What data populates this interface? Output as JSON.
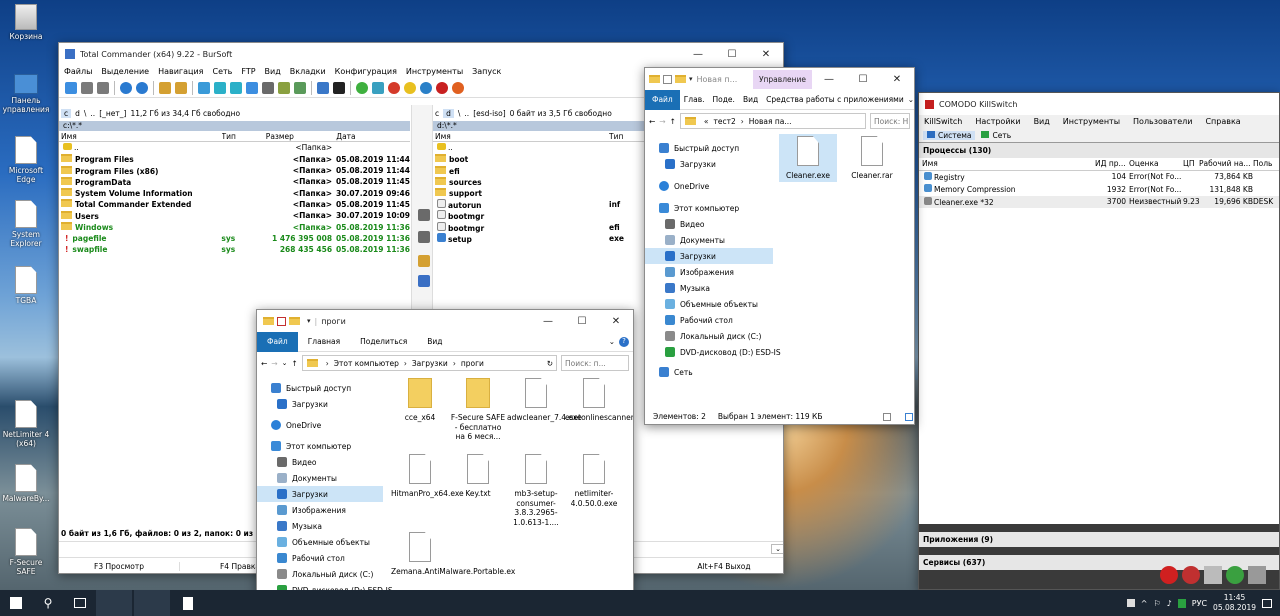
{
  "desktop": {
    "icons": [
      "Корзина",
      "Панель управления",
      "Microsoft Edge",
      "System Explorer",
      "TGBA",
      "NetLimiter 4 (x64)",
      "MalwareBy...",
      "F-Secure SAFE"
    ]
  },
  "tc": {
    "title": "Total Commander (x64) 9.22 - BurSoft",
    "menu": [
      "Файлы",
      "Выделение",
      "Навигация",
      "Сеть",
      "FTP",
      "Вид",
      "Вкладки",
      "Конфигурация",
      "Инструменты",
      "Запуск"
    ],
    "left": {
      "drive": "c",
      "drive2": "d",
      "backslash": "\\",
      "dots": "..",
      "label": "[_нет_]",
      "free": "11,2 Гб из 34,4 Гб свободно",
      "path": "c:\\*.*",
      "headers": [
        "Имя",
        "Тип",
        "Размер",
        "Дата"
      ],
      "rows": [
        {
          "name": "..",
          "type": "",
          "size": "<Папка>",
          "date": "",
          "cls": ""
        },
        {
          "name": "Program Files",
          "type": "",
          "size": "<Папка>",
          "date": "05.08.2019 11:44",
          "cls": ""
        },
        {
          "name": "Program Files (x86)",
          "type": "",
          "size": "<Папка>",
          "date": "05.08.2019 11:44",
          "cls": ""
        },
        {
          "name": "ProgramData",
          "type": "",
          "size": "<Папка>",
          "date": "05.08.2019 11:45",
          "cls": ""
        },
        {
          "name": "System Volume Information",
          "type": "",
          "size": "<Папка>",
          "date": "30.07.2019 09:46",
          "cls": ""
        },
        {
          "name": "Total Commander Extended",
          "type": "",
          "size": "<Папка>",
          "date": "05.08.2019 11:45",
          "cls": ""
        },
        {
          "name": "Users",
          "type": "",
          "size": "<Папка>",
          "date": "30.07.2019 10:09",
          "cls": ""
        },
        {
          "name": "Windows",
          "type": "",
          "size": "<Папка>",
          "date": "05.08.2019 11:36",
          "cls": "green"
        },
        {
          "name": "pagefile",
          "type": "sys",
          "size": "1 476 395 008",
          "date": "05.08.2019 11:36",
          "cls": "green"
        },
        {
          "name": "swapfile",
          "type": "sys",
          "size": "268 435 456",
          "date": "05.08.2019 11:36",
          "cls": "green"
        }
      ],
      "status": "0 байт из 1,6 Гб, файлов: 0 из 2, папок: 0 из 11"
    },
    "right": {
      "drive": "c",
      "drive2": "d",
      "backslash": "\\",
      "dots": "..",
      "label": "[esd-iso]",
      "free": "0 байт из 3,5 Гб свободно",
      "path": "d:\\*.*",
      "headers": [
        "Имя",
        "Тип"
      ],
      "rows": [
        {
          "name": "..",
          "type": ""
        },
        {
          "name": "boot",
          "type": ""
        },
        {
          "name": "efi",
          "type": ""
        },
        {
          "name": "sources",
          "type": ""
        },
        {
          "name": "support",
          "type": ""
        },
        {
          "name": "autorun",
          "type": "inf"
        },
        {
          "name": "bootmgr",
          "type": ""
        },
        {
          "name": "bootmgr",
          "type": "efi"
        },
        {
          "name": "setup",
          "type": "exe"
        }
      ]
    },
    "fkeys": [
      "F3 Просмотр",
      "F4 Правка",
      "Alt+F4 Выход"
    ]
  },
  "exp1": {
    "title": "проги",
    "tabs": [
      "Файл",
      "Главная",
      "Поделиться",
      "Вид"
    ],
    "crumbs": [
      "Этот компьютер",
      "Загрузки",
      "проги"
    ],
    "search": "Поиск: п...",
    "nav": [
      "Быстрый доступ",
      "Загрузки",
      "OneDrive",
      "Этот компьютер",
      "Видео",
      "Документы",
      "Загрузки",
      "Изображения",
      "Музыка",
      "Объемные объекты",
      "Рабочий стол",
      "Локальный диск (C:)",
      "DVD-дисковод (D:) ESD-IS"
    ],
    "files": [
      "cce_x64",
      "F-Secure SAFE - бесплатно на 6 меся...",
      "adwcleaner_7.4.exe",
      "esetonlinescanner_rus.exe",
      "HitmanPro_x64.exe",
      "Key.txt",
      "mb3-setup-consumer-3.8.3.2965-1.0.613-1....",
      "netlimiter-4.0.50.0.exe",
      "Zemana.AntiMalware.Portable.ex"
    ]
  },
  "exp2": {
    "title": "Новая п...",
    "ribbon_extra": "Управление",
    "tabs": [
      "Файл",
      "Глав.",
      "Поде.",
      "Вид",
      "Средства работы с приложениями"
    ],
    "crumbs": [
      "тест2",
      "Новая па..."
    ],
    "search": "Поиск: Н",
    "nav": [
      "Быстрый доступ",
      "Загрузки",
      "OneDrive",
      "Этот компьютер",
      "Видео",
      "Документы",
      "Загрузки",
      "Изображения",
      "Музыка",
      "Объемные объекты",
      "Рабочий стол",
      "Локальный диск (C:)",
      "DVD-дисковод (D:) ESD-IS",
      "Сеть"
    ],
    "files": [
      "Cleaner.exe",
      "Cleaner.rar"
    ],
    "status_count": "Элементов: 2",
    "status_sel": "Выбран 1 элемент: 119 КБ"
  },
  "killswitch": {
    "title": "COMODO KillSwitch",
    "menu": [
      "KillSwitch",
      "Настройки",
      "Вид",
      "Инструменты",
      "Пользователи",
      "Справка"
    ],
    "tabs": [
      "Система",
      "Сеть"
    ],
    "processes_header": "Процессы (130)",
    "columns": [
      "Имя",
      "ИД пр...",
      "Оценка",
      "ЦП",
      "Рабочий на...",
      "Поль"
    ],
    "rows": [
      {
        "name": "Registry",
        "pid": "104",
        "rating": "Error(Not Fo...",
        "cpu": "",
        "mem": "73,864 KB",
        "user": ""
      },
      {
        "name": "Memory Compression",
        "pid": "1932",
        "rating": "Error(Not Fo...",
        "cpu": "",
        "mem": "131,848 KB",
        "user": ""
      },
      {
        "name": "Cleaner.exe *32",
        "pid": "3700",
        "rating": "Неизвестный",
        "cpu": "9.23",
        "mem": "19,696 KB",
        "user": "DESK"
      }
    ],
    "apps_header": "Приложения (9)",
    "services_header": "Сервисы (637)"
  },
  "taskbar": {
    "lang": "РУС",
    "time": "11:45",
    "date": "05.08.2019"
  },
  "colors": {
    "selection": "#cce4f7",
    "accent": "#1a6fb5",
    "tc_header": "#cfe0f4",
    "green": "#1a8a1a"
  }
}
